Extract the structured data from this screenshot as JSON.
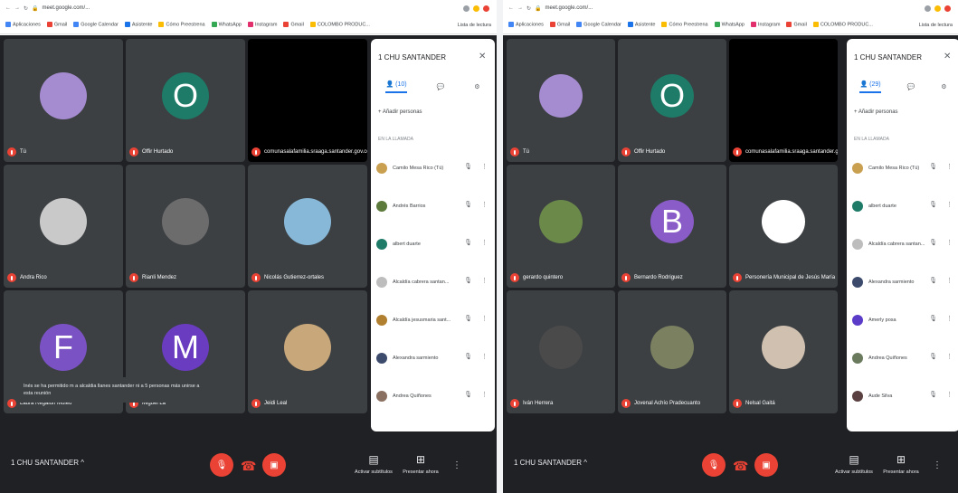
{
  "window1": {
    "browser": {
      "url": "meet.google.com/...",
      "bookmarks": [
        "Aplicaciones",
        "Gmail",
        "Google Calendar",
        "Asistente",
        "Cómo Preestrena",
        "WhatsApp",
        "Instagram",
        "Gmail",
        "COLOMBO PRODUC..."
      ],
      "reading_list": "Lista de lectura"
    },
    "tiles": [
      {
        "name": "Tú",
        "avatar_color": "#a58bd0",
        "initial": ""
      },
      {
        "name": "Offir Hurtado",
        "avatar_color": "#1e7b67",
        "initial": "O"
      },
      {
        "name": "comunasalafamilia.sraaga.santander.gov.co",
        "avatar_color": "",
        "initial": ""
      },
      {
        "name": "Andra Rico",
        "avatar_color": "#c9c9c9",
        "initial": ""
      },
      {
        "name": "Rianli Mendez",
        "avatar_color": "#6c6c6c",
        "initial": ""
      },
      {
        "name": "Nicolás Gutierrez-ortales",
        "avatar_color": "#88b8d8",
        "initial": ""
      },
      {
        "name": "Laura Regalón Moleo",
        "avatar_color": "#7b52c4",
        "initial": "F"
      },
      {
        "name": "Miguel La",
        "avatar_color": "#6a3cc0",
        "initial": "M"
      },
      {
        "name": "Jeidi Leal",
        "avatar_color": "#c8a77a",
        "initial": ""
      }
    ],
    "toast": "Inés se ha permitido m a alcaldia llanes santander ni a 5 personas más unirse a esta reunión",
    "panel": {
      "title": "1 CHU SANTANDER",
      "tab_people": "(10)",
      "add_people": "Añadir personas",
      "section": "EN LA LLAMADA",
      "people": [
        {
          "name": "Camilo Mesa Rico (Tú)",
          "color": "#c9a050"
        },
        {
          "name": "Andrés Barrios",
          "color": "#5c7a3c"
        },
        {
          "name": "albert duarte",
          "color": "#1e7b67"
        },
        {
          "name": "Alcaldía cabrera santan...",
          "color": "#bdbdbd"
        },
        {
          "name": "Alcaldía jesusmaria sant...",
          "color": "#b08030"
        },
        {
          "name": "Alexandra sarmiento",
          "color": "#3c4a6c"
        },
        {
          "name": "Andrea Quiñones",
          "color": "#8a7060"
        }
      ]
    },
    "bar": {
      "meeting_title": "1 CHU SANTANDER  ^",
      "captions": "Activar subtítulos",
      "present": "Presentar ahora"
    }
  },
  "window2": {
    "browser": {
      "url": "meet.google.com/...",
      "bookmarks": [
        "Aplicaciones",
        "Gmail",
        "Google Calendar",
        "Asistente",
        "Cómo Preestrena",
        "WhatsApp",
        "Instagram",
        "Gmail",
        "COLOMBO PRODUC..."
      ],
      "reading_list": "Lista de lectura"
    },
    "tiles": [
      {
        "name": "Tú",
        "avatar_color": "#a58bd0",
        "initial": ""
      },
      {
        "name": "Offir Hurtado",
        "avatar_color": "#1e7b67",
        "initial": "O"
      },
      {
        "name": "comunasalafamilia.sraaga.santander.gov.co",
        "avatar_color": "",
        "initial": ""
      },
      {
        "name": "gerardo quintero",
        "avatar_color": "#6b8a4a",
        "initial": ""
      },
      {
        "name": "Bernardo Rodriguez",
        "avatar_color": "#8a5cc8",
        "initial": "B"
      },
      {
        "name": "Personería Municipal de Jesús María",
        "avatar_color": "#ffffff",
        "initial": ""
      },
      {
        "name": "Iván Herrera",
        "avatar_color": "#4a4a4a",
        "initial": ""
      },
      {
        "name": "Jovenal Achío Pradecuanto",
        "avatar_color": "#7a8060",
        "initial": ""
      },
      {
        "name": "Nelsal Gaitá",
        "avatar_color": "#d0c0b0",
        "initial": ""
      }
    ],
    "panel": {
      "title": "1 CHU SANTANDER",
      "tab_people": "(29)",
      "add_people": "Añadir personas",
      "section": "EN LA LLAMADA",
      "people": [
        {
          "name": "Camilo Mesa Rico (Tú)",
          "color": "#c9a050"
        },
        {
          "name": "albert duarte",
          "color": "#1e7b67"
        },
        {
          "name": "Alcaldía cabrera santan...",
          "color": "#bdbdbd"
        },
        {
          "name": "Alexandra sarmiento",
          "color": "#3c4a6c"
        },
        {
          "name": "Amerly posa",
          "color": "#5a3cc8"
        },
        {
          "name": "Andrea Quiñones",
          "color": "#6a7a5c"
        },
        {
          "name": "Aude Silva",
          "color": "#5a4040"
        }
      ]
    },
    "bar": {
      "meeting_title": "1 CHU SANTANDER  ^",
      "captions": "Activar subtítulos",
      "present": "Presentar ahora"
    }
  }
}
